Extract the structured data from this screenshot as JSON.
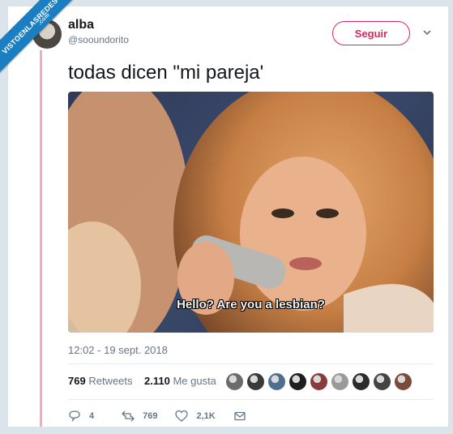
{
  "watermark": {
    "text": "VISTOENLASREDES",
    "sub": ".com"
  },
  "tweet": {
    "display_name": "alba",
    "handle": "@sooundorito",
    "follow_label": "Seguir",
    "text": "todas dicen \"mi pareja'",
    "media": {
      "subtitle": "Hello? Are you a lesbian?"
    },
    "timestamp": "12:02 - 19 sept. 2018",
    "stats": {
      "retweets_count": "769",
      "retweets_label": "Retweets",
      "likes_count": "2.110",
      "likes_label": "Me gusta"
    },
    "likers": [
      {
        "icon": "liker-avatar-1",
        "color": "#6b6b6b"
      },
      {
        "icon": "liker-avatar-2",
        "color": "#3a3a3a"
      },
      {
        "icon": "liker-avatar-3",
        "color": "#4f6f8f"
      },
      {
        "icon": "liker-avatar-4",
        "color": "#1f1f1f"
      },
      {
        "icon": "liker-avatar-5",
        "color": "#8a3b3b"
      },
      {
        "icon": "liker-avatar-6",
        "color": "#9a9a9a"
      },
      {
        "icon": "liker-avatar-7",
        "color": "#2b2b2b"
      },
      {
        "icon": "liker-avatar-8",
        "color": "#444444"
      },
      {
        "icon": "liker-avatar-9",
        "color": "#7a4a3a"
      }
    ],
    "actions": {
      "reply_count": "4",
      "retweet_count": "769",
      "like_count": "2,1K"
    }
  },
  "colors": {
    "accent": "#e0245e",
    "secondary_text": "#657786",
    "primary_text": "#14171a",
    "watermark": "#1a7fc2",
    "thread_line": "#f7a8c4"
  }
}
